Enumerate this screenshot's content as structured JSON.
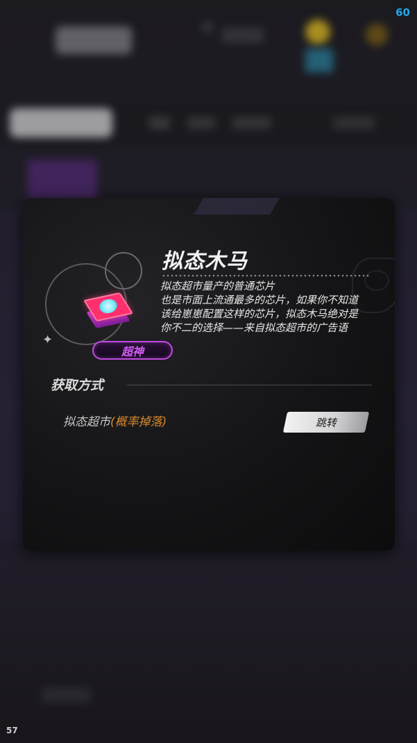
{
  "hud": {
    "fps_top": "60",
    "fps_bottom": "57"
  },
  "item": {
    "name": "拟态木马",
    "rarity": "超神",
    "rarity_color": "#c04ae0",
    "icon": "chip-icon",
    "description": "拟态超市量产的普通芯片\n也是市面上流通最多的芯片，如果你不知道该给崽崽配置这样的芯片，拟态木马绝对是你不二的选择——来自拟态超市的广告语"
  },
  "acquisition": {
    "section_title": "获取方式",
    "sources": [
      {
        "name": "拟态超市",
        "note": "(概率掉落)",
        "note_color": "#d8892a",
        "button_label": "跳转"
      }
    ]
  }
}
